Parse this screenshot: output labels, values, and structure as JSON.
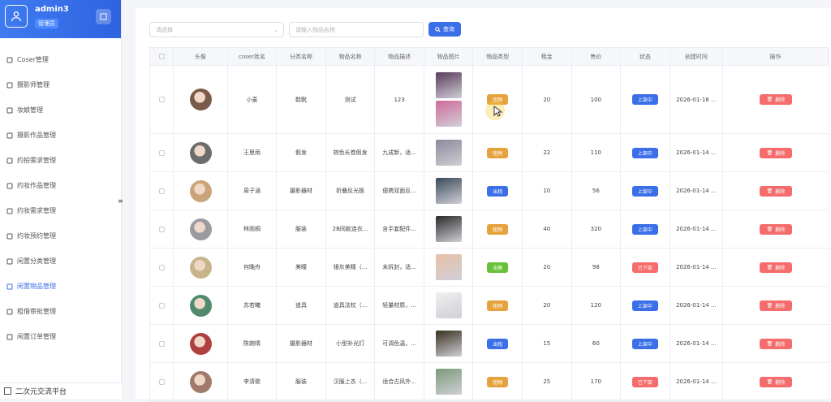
{
  "user": {
    "name": "admin3",
    "role": "管理员"
  },
  "menu": [
    {
      "label": "Coser管理",
      "icon": "user-icon"
    },
    {
      "label": "摄影师管理",
      "icon": "user-outline-icon"
    },
    {
      "label": "妆娘管理",
      "icon": "user-icon"
    },
    {
      "label": "摄影作品管理",
      "icon": "camera-icon"
    },
    {
      "label": "约拍需求管理",
      "icon": "ticket-icon"
    },
    {
      "label": "约妆作品管理",
      "icon": "document-icon"
    },
    {
      "label": "约妆需求管理",
      "icon": "document-icon"
    },
    {
      "label": "约妆预约管理",
      "icon": "send-icon"
    },
    {
      "label": "闲置分类管理",
      "icon": "grid-icon"
    },
    {
      "label": "闲置物品管理",
      "icon": "box-icon"
    },
    {
      "label": "租借审批管理",
      "icon": "clipboard-icon"
    },
    {
      "label": "闲置订单管理",
      "icon": "shop-icon"
    }
  ],
  "footer": {
    "label": "二次元交流平台"
  },
  "search": {
    "select_placeholder": "请选择",
    "input_placeholder": "请输入物品名称",
    "query_label": "查询"
  },
  "table": {
    "headers": [
      "头像",
      "coser姓名",
      "分类名称",
      "物品名称",
      "物品描述",
      "物品图片",
      "物品类型",
      "租金",
      "售价",
      "状态",
      "创建时间",
      "操作"
    ],
    "delete_label": "删除",
    "rows": [
      {
        "name": "小麦",
        "category": "鞋靴",
        "item": "测试",
        "desc": "123",
        "type": "租物",
        "rent": "20",
        "price": "100",
        "status": "上架中",
        "created": "2026-01-18 ..."
      },
      {
        "name": "王思雨",
        "category": "假发",
        "item": "棕色长卷假发",
        "desc": "九成新，适...",
        "type": "租物",
        "rent": "22",
        "price": "110",
        "status": "上架中",
        "created": "2026-01-14 ..."
      },
      {
        "name": "周子涵",
        "category": "摄影器材",
        "item": "折叠反光板",
        "desc": "便携双面反...",
        "type": "出租",
        "rent": "10",
        "price": "56",
        "status": "上架中",
        "created": "2026-01-14 ..."
      },
      {
        "name": "林雨桐",
        "category": "服装",
        "item": "2B同款连衣...",
        "desc": "含手套配件...",
        "type": "租物",
        "rent": "40",
        "price": "320",
        "status": "上架中",
        "created": "2026-01-14 ..."
      },
      {
        "name": "何晚舟",
        "category": "美瞳",
        "item": "银灰美瞳（...",
        "desc": "未拆封，适...",
        "type": "出售",
        "rent": "20",
        "price": "98",
        "status": "已下架",
        "created": "2026-01-14 ..."
      },
      {
        "name": "苏若曦",
        "category": "道具",
        "item": "道具法杖（...",
        "desc": "轻量材质，...",
        "type": "租物",
        "rent": "20",
        "price": "120",
        "status": "上架中",
        "created": "2026-01-14 ..."
      },
      {
        "name": "陈婉晴",
        "category": "摄影器材",
        "item": "小型补光灯",
        "desc": "可调色温，...",
        "type": "出租",
        "rent": "15",
        "price": "60",
        "status": "上架中",
        "created": "2026-01-14 ..."
      },
      {
        "name": "李清歌",
        "category": "服装",
        "item": "汉服上衣（...",
        "desc": "适合古风外...",
        "type": "租物",
        "rent": "25",
        "price": "170",
        "status": "已下架",
        "created": "2026-01-14 ..."
      }
    ]
  },
  "colors": {
    "primary": "#3b6fe8",
    "warning": "#e6a23c",
    "success": "#67c23a",
    "danger": "#f56c6c"
  }
}
